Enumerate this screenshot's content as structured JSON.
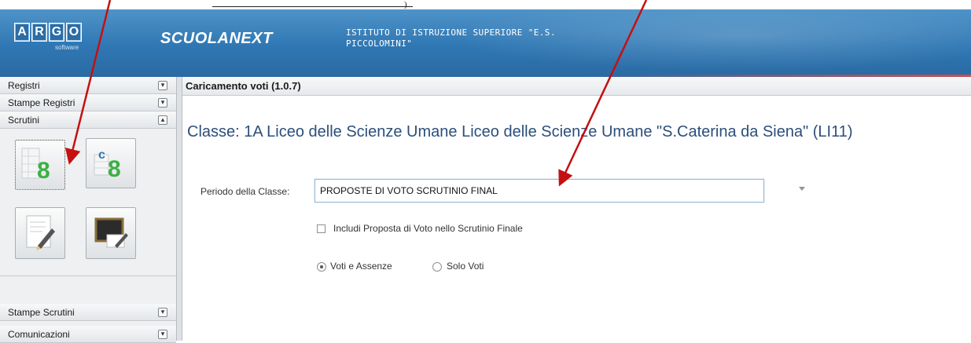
{
  "header": {
    "brand_letters": [
      "A",
      "R",
      "G",
      "O"
    ],
    "brand_sub": "software",
    "app_name": "SCUOLANEXT",
    "school_line1": "ISTITUTO DI ISTRUZIONE SUPERIORE \"E.S.",
    "school_line2": "PICCOLOMINI\""
  },
  "sidebar": {
    "menus": [
      {
        "label": "Registri",
        "toggle": "▾"
      },
      {
        "label": "Stampe Registri",
        "toggle": "▾"
      },
      {
        "label": "Scrutini",
        "toggle": "▴"
      },
      {
        "label": "Stampe Scrutini",
        "toggle": "▾"
      },
      {
        "label": "Comunicazioni",
        "toggle": "▾"
      }
    ],
    "scrutini_icons": [
      "grade-entry-icon",
      "grade-refresh-icon",
      "notes-edit-icon",
      "blackboard-edit-icon"
    ],
    "icon_glyph": "8",
    "refresh_glyph": "c"
  },
  "panel": {
    "title": "Caricamento voti (1.0.7)",
    "class_title": "Classe: 1A Liceo delle Scienze Umane Liceo delle Scienze Umane \"S.Caterina da Siena\" (LI11)",
    "period_label": "Periodo della Classe:",
    "period_value": "PROPOSTE DI VOTO SCRUTINIO FINAL",
    "checkbox_label": "Includi Proposta di Voto nello Scrutinio Finale",
    "radio_options": [
      "Voti e Assenze",
      "Solo Voti"
    ],
    "radio_selected": 0
  },
  "top_fragment": ")",
  "colors": {
    "header_blue": "#2f77b3",
    "title_blue": "#2b4f7a",
    "arrow_red": "#c41010",
    "grade_green": "#3cb043"
  }
}
